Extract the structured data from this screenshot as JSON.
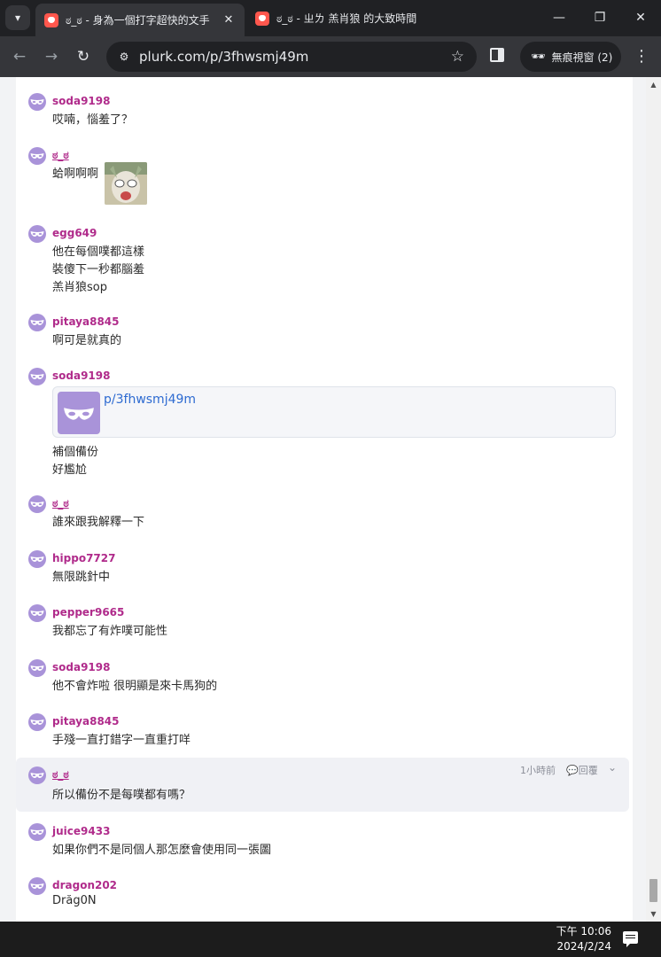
{
  "browser": {
    "tabs": [
      {
        "title": "ಠ_ಠ - 身為一個打字超快的文手",
        "active": true
      },
      {
        "title": "ಠ_ಠ - ㄓㄌ 羔肖狼 的大致時間",
        "active": false
      }
    ],
    "url": "plurk.com/p/3fhwsmj49m",
    "incognito_label": "無痕視窗 (2)",
    "icons": {
      "tab_search": "chevron-down-icon",
      "close": "close-icon",
      "back": "back-arrow-icon",
      "forward": "forward-arrow-icon",
      "reload": "reload-icon",
      "site_info": "tune-icon",
      "bookmark": "star-icon",
      "side_panel": "side-panel-icon",
      "incognito": "incognito-icon",
      "menu": "kebab-menu-icon"
    },
    "window_controls": {
      "minimize": "—",
      "restore": "❐",
      "close": "✕"
    }
  },
  "responses": [
    {
      "user": "soda9198",
      "lines": [
        "哎喃，惱羞了？"
      ]
    },
    {
      "user": "ಠ_ಠ",
      "lines": [
        "蛤啊啊啊"
      ],
      "has_image": true
    },
    {
      "user": "egg649",
      "lines": [
        "他在每個噗都這樣",
        "裝傻下一秒都腦羞",
        "羔肖狼sop"
      ]
    },
    {
      "user": "pitaya8845",
      "lines": [
        "啊可是就真的"
      ]
    },
    {
      "user": "soda9198",
      "link_card": {
        "text": "p/3fhwsmj49m"
      },
      "lines": [
        "補個備份",
        "好尷尬"
      ]
    },
    {
      "user": "ಠ_ಠ",
      "lines": [
        "誰來跟我解釋一下"
      ]
    },
    {
      "user": "hippo7727",
      "lines": [
        "無限跳針中"
      ]
    },
    {
      "user": "pepper9665",
      "lines": [
        "我都忘了有炸噗可能性"
      ]
    },
    {
      "user": "soda9198",
      "lines": [
        "他不會炸啦 很明顯是來卡馬狗的"
      ]
    },
    {
      "user": "pitaya8845",
      "lines": [
        "手殘一直打錯字一直重打咩"
      ]
    },
    {
      "user": "ಠ_ಠ",
      "lines": [
        "所以備份不是每噗都有嗎？"
      ],
      "time": "1小時前",
      "reply_label": "回覆"
    },
    {
      "user": "juice9433",
      "lines": [
        "如果你們不是同個人那怎麼會使用同一張圖"
      ]
    },
    {
      "user": "dragon202",
      "lines": [
        "Drăg0N"
      ]
    }
  ],
  "taskbar": {
    "time": "下午 10:06",
    "date": "2024/2/24"
  },
  "colors": {
    "username": "#b02b8b",
    "avatar": "#a993d9",
    "link": "#2e6bd1",
    "highlight_bg": "#f0f1f5"
  }
}
